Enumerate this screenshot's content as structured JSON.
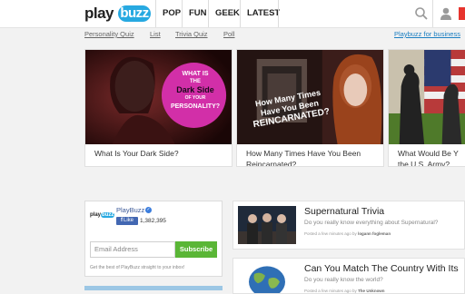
{
  "header": {
    "logo": {
      "part1": "play",
      "part2": "buzz"
    },
    "nav": [
      "POP",
      "FUN",
      "GEEK",
      "LATEST"
    ],
    "icons": [
      "search-icon",
      "user-icon"
    ]
  },
  "subnav": {
    "links": [
      "Personality Quiz",
      "List",
      "Trivia Quiz",
      "Poll"
    ],
    "business": "Playbuzz for business"
  },
  "cards": [
    {
      "caption": "What Is Your Dark Side?",
      "overlay": {
        "line1": "WHAT IS",
        "line2": "THE",
        "line3": "Dark Side",
        "line4": "OF YOUR",
        "line5": "PERSONALITY?"
      }
    },
    {
      "caption": "How Many Times Have You Been Reincarnated?",
      "overlay": {
        "line1": "How Many Times",
        "line2": "Have You Been",
        "line3": "REINCARNATED?"
      }
    },
    {
      "caption": "What Would Be Your Rank in the U.S. Army?",
      "caption_visible": "What Would Be Y the U.S. Army?"
    }
  ],
  "widget": {
    "name": "PlayBuzz",
    "like_label": "Like",
    "like_count": "1,382,395",
    "email_placeholder": "Email Address",
    "subscribe_label": "Subscribe",
    "note": "Get the best of PlayBuzz straight to your inbox!"
  },
  "feed": [
    {
      "title": "Supernatural Trivia",
      "subtitle": "Do you really know everything about Supernatural?",
      "meta_prefix": "Posted a few minutes ago by",
      "author": "logann fogleman"
    },
    {
      "title": "Can You Match The Country With Its",
      "subtitle": "Do you really know the world?",
      "meta_prefix": "Posted a few minutes ago by",
      "author": "The Unknown"
    }
  ],
  "colors": {
    "brand_blue": "#27a9e1",
    "subscribe_green": "#5ab636",
    "facebook_blue": "#4267b2",
    "accent_red": "#e7342d"
  }
}
